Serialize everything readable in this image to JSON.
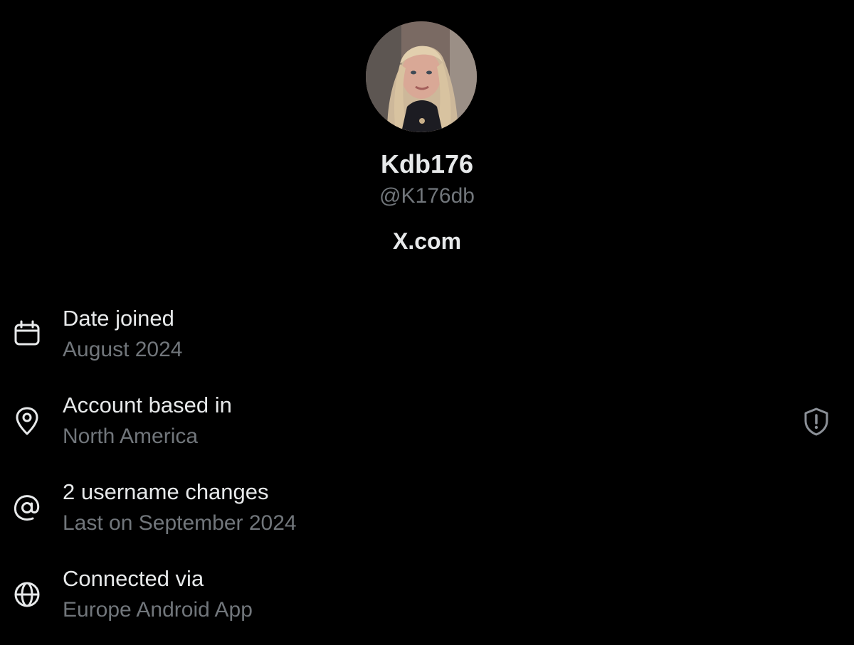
{
  "profile": {
    "avatar_icon": "profile-photo",
    "display_name": "Kdb176",
    "handle": "@K176db",
    "site": "X.com"
  },
  "info": [
    {
      "icon": "calendar-icon",
      "title": "Date joined",
      "value": "August 2024"
    },
    {
      "icon": "location-pin-icon",
      "title": "Account based in",
      "value": "North America",
      "trailing_icon": "shield-alert-icon"
    },
    {
      "icon": "at-sign-icon",
      "title": "2 username changes",
      "value": "Last on September 2024"
    },
    {
      "icon": "globe-icon",
      "title": "Connected via",
      "value": "Europe Android App"
    }
  ],
  "colors": {
    "background": "#000000",
    "primary_text": "#e7e9ea",
    "secondary_text": "#71767b"
  }
}
